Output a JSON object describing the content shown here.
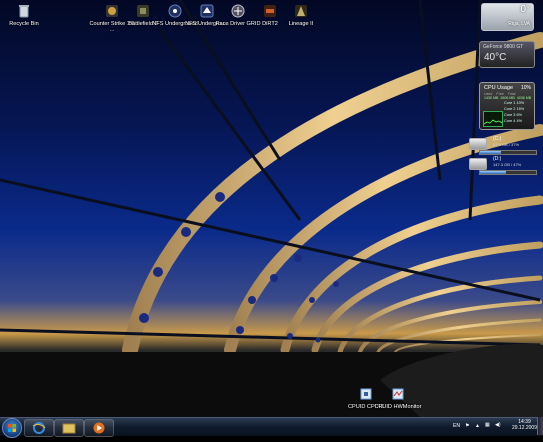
{
  "desktop": {
    "icons": [
      {
        "label": "Recycle Bin",
        "icon": "recycle-bin-icon",
        "color": "#c8d0d8"
      },
      {
        "label": "Counter Strike 1.6 ...",
        "icon": "counter-strike-icon",
        "color": "#d0a040"
      },
      {
        "label": "Battlefield 2",
        "icon": "battlefield-icon",
        "color": "#889060"
      },
      {
        "label": "NFS Underground",
        "icon": "nfs-icon",
        "color": "#6080c0"
      },
      {
        "label": "NFS Undergrou...",
        "icon": "nfs-icon",
        "color": "#6080c0"
      },
      {
        "label": "Race Driver GRID",
        "icon": "grid-icon",
        "color": "#c0c0d0"
      },
      {
        "label": "DiRT2",
        "icon": "dirt2-icon",
        "color": "#d06030"
      },
      {
        "label": "Lineage II",
        "icon": "lineage-icon",
        "color": "#c0b070"
      }
    ],
    "bottom_icons": [
      {
        "label": "CPUID CPU-Z",
        "icon": "cpuz-icon",
        "color": "#6aa0e0"
      },
      {
        "label": "CPUID HWMonitor",
        "icon": "hwmonitor-icon",
        "color": "#6aa0e0"
      }
    ]
  },
  "gadgets": {
    "weather": {
      "temp": "0°",
      "city": "Riga, LVA"
    },
    "gpu": {
      "name": "GeForce 9800 GT",
      "temp": "40°C"
    },
    "cpu": {
      "title": "CPU Usage",
      "percent": "10%",
      "columns": [
        "Used",
        "Free",
        "Total"
      ],
      "mem": [
        "1430 MB",
        "2606 MB",
        "4036 MB"
      ],
      "cores": [
        {
          "label": "Core 1",
          "value": "10%"
        },
        {
          "label": "Core 2",
          "value": "15%"
        },
        {
          "label": "Core 3",
          "value": "6%"
        },
        {
          "label": "Core 4",
          "value": "4%"
        }
      ]
    },
    "drives": [
      {
        "label": "(C:)",
        "info": "87.9 GB / 37%",
        "used_fraction": 0.37
      },
      {
        "label": "(D:)",
        "info": "147.3 GB / 47%",
        "used_fraction": 0.47
      }
    ]
  },
  "taskbar": {
    "pinned": [
      {
        "name": "ie-icon",
        "color": "#3a8ae0"
      },
      {
        "name": "explorer-icon",
        "color": "#e0c060"
      },
      {
        "name": "media-player-icon",
        "color": "#e07020"
      }
    ],
    "tray_lang": "EN",
    "time": "14:39",
    "date": "29.12.2009"
  }
}
